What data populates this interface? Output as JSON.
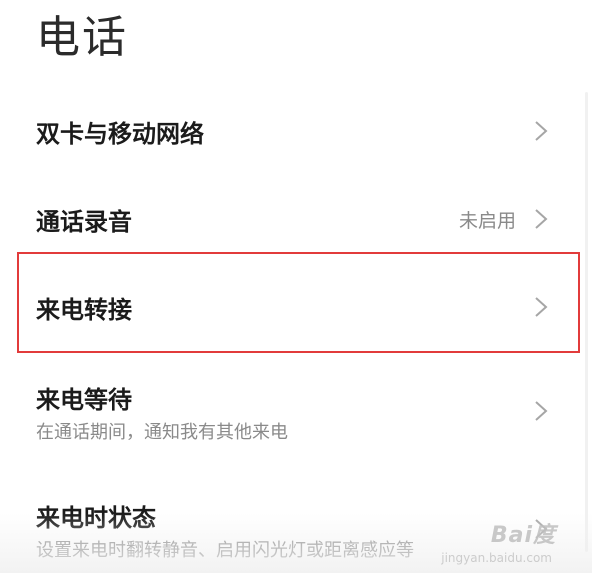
{
  "header": {
    "title": "电话"
  },
  "settings": [
    {
      "title": "双卡与移动网络",
      "subtitle": "",
      "value": ""
    },
    {
      "title": "通话录音",
      "subtitle": "",
      "value": "未启用"
    },
    {
      "title": "来电转接",
      "subtitle": "",
      "value": ""
    },
    {
      "title": "来电等待",
      "subtitle": "在通话期间，通知我有其他来电",
      "value": ""
    },
    {
      "title": "来电时状态",
      "subtitle": "设置来电时翻转静音、启用闪光灯或距离感应等",
      "value": ""
    }
  ],
  "watermark": {
    "logo": "Bai度",
    "caption": "jingyan.baidu.com"
  },
  "colors": {
    "highlight": "#e23b3b",
    "chevron": "#a6a6a6"
  },
  "icons": {
    "chevron": "chevron-right-icon"
  }
}
